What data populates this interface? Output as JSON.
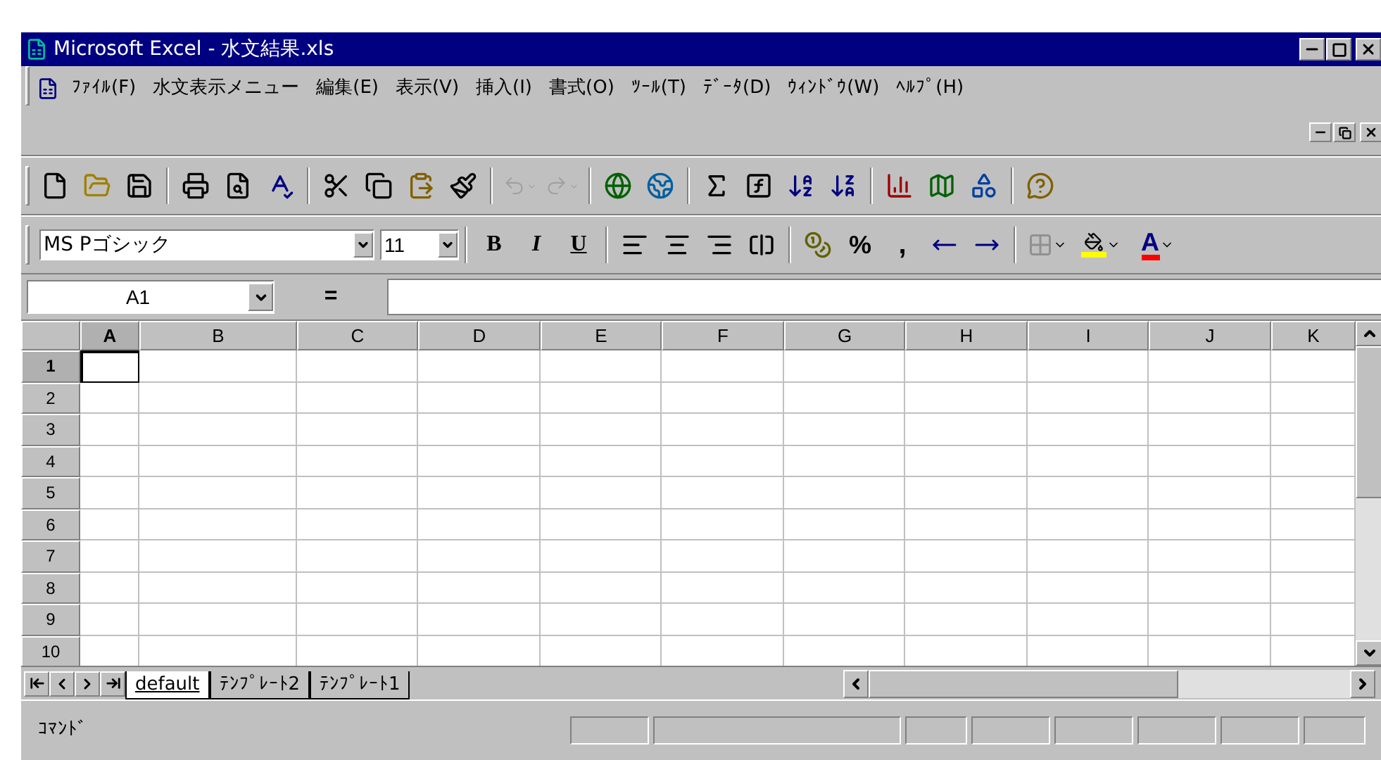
{
  "window": {
    "title": "Microsoft Excel - 水文結果.xls"
  },
  "menu": [
    {
      "label": "ﾌｧｲﾙ(F)"
    },
    {
      "label": "水文表示メニュー"
    },
    {
      "label": "編集(E)"
    },
    {
      "label": "表示(V)"
    },
    {
      "label": "挿入(I)"
    },
    {
      "label": "書式(O)"
    },
    {
      "label": "ﾂｰﾙ(T)"
    },
    {
      "label": "ﾃﾞｰﾀ(D)"
    },
    {
      "label": "ｳｨﾝﾄﾞｳ(W)"
    },
    {
      "label": "ﾍﾙﾌﾟ(H)"
    }
  ],
  "standard_toolbar": [
    [
      {
        "kind": "new",
        "disabled": false
      },
      {
        "kind": "open",
        "disabled": false
      },
      {
        "kind": "save",
        "disabled": false
      }
    ],
    [
      {
        "kind": "print",
        "disabled": false
      },
      {
        "kind": "preview",
        "disabled": false
      },
      {
        "kind": "spell",
        "disabled": false
      }
    ],
    [
      {
        "kind": "cut",
        "disabled": false
      },
      {
        "kind": "copy",
        "disabled": false
      },
      {
        "kind": "paste",
        "disabled": false
      },
      {
        "kind": "brush",
        "disabled": false
      }
    ],
    [
      {
        "kind": "undo",
        "disabled": true
      },
      {
        "kind": "redo",
        "disabled": true
      }
    ],
    [
      {
        "kind": "web",
        "disabled": false
      },
      {
        "kind": "link",
        "disabled": false
      }
    ],
    [
      {
        "kind": "sum",
        "disabled": false
      },
      {
        "kind": "function",
        "disabled": false
      },
      {
        "kind": "sortasc",
        "disabled": false
      },
      {
        "kind": "sortdesc",
        "disabled": false
      }
    ],
    [
      {
        "kind": "chart",
        "disabled": false
      },
      {
        "kind": "map",
        "disabled": false
      },
      {
        "kind": "drawing",
        "disabled": false
      }
    ],
    [
      {
        "kind": "help",
        "disabled": false
      }
    ]
  ],
  "format_toolbar": {
    "font": "MS Pゴシック",
    "size": "11",
    "bold": "B",
    "italic": "I",
    "underline": "U",
    "percent": "%",
    "comma": ",",
    "font_color": "A"
  },
  "formula_bar": {
    "name_box": "A1",
    "equals": "="
  },
  "columns": [
    {
      "label": "A",
      "selected": true
    },
    {
      "label": "B",
      "selected": false
    },
    {
      "label": "C",
      "selected": false
    },
    {
      "label": "D",
      "selected": false
    },
    {
      "label": "E",
      "selected": false
    },
    {
      "label": "F",
      "selected": false
    },
    {
      "label": "G",
      "selected": false
    },
    {
      "label": "H",
      "selected": false
    },
    {
      "label": "I",
      "selected": false
    },
    {
      "label": "J",
      "selected": false
    },
    {
      "label": "K",
      "selected": false
    }
  ],
  "rows": [
    {
      "label": "1",
      "selected": true
    },
    {
      "label": "2",
      "selected": false
    },
    {
      "label": "3",
      "selected": false
    },
    {
      "label": "4",
      "selected": false
    },
    {
      "label": "5",
      "selected": false
    },
    {
      "label": "6",
      "selected": false
    },
    {
      "label": "7",
      "selected": false
    },
    {
      "label": "8",
      "selected": false
    },
    {
      "label": "9",
      "selected": false
    },
    {
      "label": "10",
      "selected": false
    }
  ],
  "sheet_tabs": [
    {
      "label": "default",
      "selected": true
    },
    {
      "label": "ﾃﾝﾌﾟﾚｰﾄ2",
      "selected": false
    },
    {
      "label": "ﾃﾝﾌﾟﾚｰﾄ1",
      "selected": false
    }
  ],
  "status_bar": {
    "text": "ｺﾏﾝﾄﾞ"
  }
}
